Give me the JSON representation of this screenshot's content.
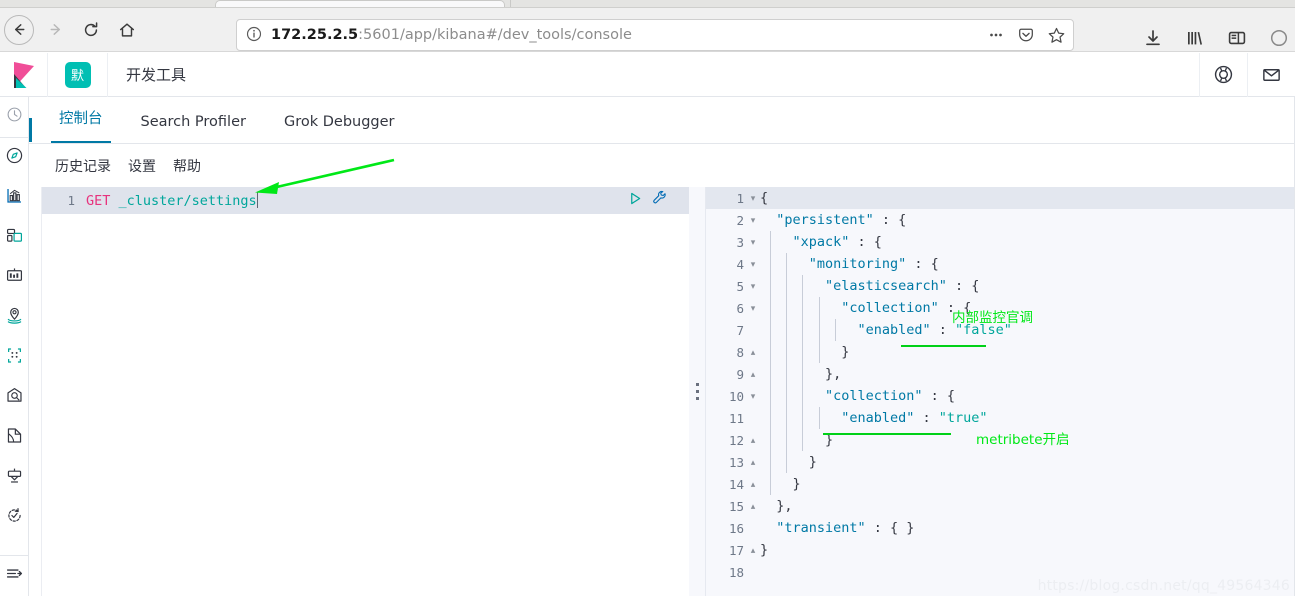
{
  "browser": {
    "url_host": "172.25.2.5",
    "url_rest": ":5601/app/kibana#/dev_tools/console",
    "nav": {
      "back": "back-button",
      "forward": "forward-button",
      "reload": "reload-button",
      "home": "home-button"
    },
    "urlbar_icons": [
      "site-info-icon",
      "page-actions-icon",
      "pocket-icon",
      "bookmark-star-icon"
    ],
    "toolbar_icons": [
      "downloads-icon",
      "library-icon",
      "sidebar-icon",
      "account-icon"
    ]
  },
  "kibana": {
    "space_badge": "默",
    "app_title": "开发工具",
    "header_icons": [
      "help-icon",
      "newsfeed-mail-icon"
    ]
  },
  "rail": {
    "items": [
      {
        "name": "recently-viewed-icon"
      },
      {
        "name": "discover-icon"
      },
      {
        "name": "visualize-icon"
      },
      {
        "name": "dashboard-icon"
      },
      {
        "name": "canvas-icon"
      },
      {
        "name": "maps-icon"
      },
      {
        "name": "machine-learning-icon"
      },
      {
        "name": "infrastructure-icon"
      },
      {
        "name": "logs-icon"
      },
      {
        "name": "apm-icon"
      },
      {
        "name": "uptime-icon"
      },
      {
        "name": "collapse-nav-icon"
      }
    ]
  },
  "tabs": [
    {
      "label": "控制台",
      "active": true
    },
    {
      "label": "Search Profiler",
      "active": false
    },
    {
      "label": "Grok Debugger",
      "active": false
    }
  ],
  "console_menu": [
    "历史记录",
    "设置",
    "帮助"
  ],
  "request_editor": {
    "line_number": "1",
    "method": "GET",
    "path": " _cluster/settings",
    "actions": [
      "play-run-icon",
      "wrench-settings-icon"
    ]
  },
  "response_editor": {
    "lines": [
      {
        "n": "1",
        "fold": "▾",
        "indent": 0,
        "guides": 0,
        "segments": [
          {
            "t": "{",
            "c": "jpunc"
          }
        ]
      },
      {
        "n": "2",
        "fold": "▾",
        "indent": 1,
        "guides": 0,
        "segments": [
          {
            "t": "\"persistent\"",
            "c": "jkey"
          },
          {
            "t": " : {",
            "c": "jpunc"
          }
        ]
      },
      {
        "n": "3",
        "fold": "▾",
        "indent": 2,
        "guides": 1,
        "segments": [
          {
            "t": "\"xpack\"",
            "c": "jkey"
          },
          {
            "t": " : {",
            "c": "jpunc"
          }
        ]
      },
      {
        "n": "4",
        "fold": "▾",
        "indent": 3,
        "guides": 2,
        "segments": [
          {
            "t": "\"monitoring\"",
            "c": "jkey"
          },
          {
            "t": " : {",
            "c": "jpunc"
          }
        ]
      },
      {
        "n": "5",
        "fold": "▾",
        "indent": 4,
        "guides": 3,
        "segments": [
          {
            "t": "\"elasticsearch\"",
            "c": "jkey"
          },
          {
            "t": " : {",
            "c": "jpunc"
          }
        ]
      },
      {
        "n": "6",
        "fold": "▾",
        "indent": 5,
        "guides": 4,
        "segments": [
          {
            "t": "\"collection\"",
            "c": "jkey"
          },
          {
            "t": " : {",
            "c": "jpunc"
          }
        ]
      },
      {
        "n": "7",
        "fold": "",
        "indent": 6,
        "guides": 5,
        "segments": [
          {
            "t": "\"enabled\"",
            "c": "jkey"
          },
          {
            "t": " : ",
            "c": "jpunc"
          },
          {
            "t": "\"false\"",
            "c": "jval"
          }
        ]
      },
      {
        "n": "8",
        "fold": "▴",
        "indent": 5,
        "guides": 4,
        "segments": [
          {
            "t": "}",
            "c": "jpunc"
          }
        ]
      },
      {
        "n": "9",
        "fold": "▴",
        "indent": 4,
        "guides": 3,
        "segments": [
          {
            "t": "},",
            "c": "jpunc"
          }
        ]
      },
      {
        "n": "10",
        "fold": "▾",
        "indent": 4,
        "guides": 3,
        "segments": [
          {
            "t": "\"collection\"",
            "c": "jkey"
          },
          {
            "t": " : {",
            "c": "jpunc"
          }
        ]
      },
      {
        "n": "11",
        "fold": "",
        "indent": 5,
        "guides": 4,
        "segments": [
          {
            "t": "\"enabled\"",
            "c": "jkey"
          },
          {
            "t": " : ",
            "c": "jpunc"
          },
          {
            "t": "\"true\"",
            "c": "jval"
          }
        ]
      },
      {
        "n": "12",
        "fold": "▴",
        "indent": 4,
        "guides": 3,
        "segments": [
          {
            "t": "}",
            "c": "jpunc"
          }
        ]
      },
      {
        "n": "13",
        "fold": "▴",
        "indent": 3,
        "guides": 2,
        "segments": [
          {
            "t": "}",
            "c": "jpunc"
          }
        ]
      },
      {
        "n": "14",
        "fold": "▴",
        "indent": 2,
        "guides": 1,
        "segments": [
          {
            "t": "}",
            "c": "jpunc"
          }
        ]
      },
      {
        "n": "15",
        "fold": "▴",
        "indent": 1,
        "guides": 0,
        "segments": [
          {
            "t": "},",
            "c": "jpunc"
          }
        ]
      },
      {
        "n": "16",
        "fold": "",
        "indent": 1,
        "guides": 0,
        "segments": [
          {
            "t": "\"transient\"",
            "c": "jkey"
          },
          {
            "t": " : { }",
            "c": "jpunc"
          }
        ]
      },
      {
        "n": "17",
        "fold": "▴",
        "indent": 0,
        "guides": 0,
        "segments": [
          {
            "t": "}",
            "c": "jpunc"
          }
        ]
      },
      {
        "n": "18",
        "fold": "",
        "indent": 0,
        "guides": 0,
        "segments": []
      }
    ]
  },
  "annotations": {
    "arrow_target": "GET _cluster/settings",
    "note_internal_monitoring": "内部监控官调",
    "note_metricbeat": "metribete开启",
    "accent_green": "#00e817"
  },
  "watermark": "https://blog.csdn.net/qq_49564346"
}
